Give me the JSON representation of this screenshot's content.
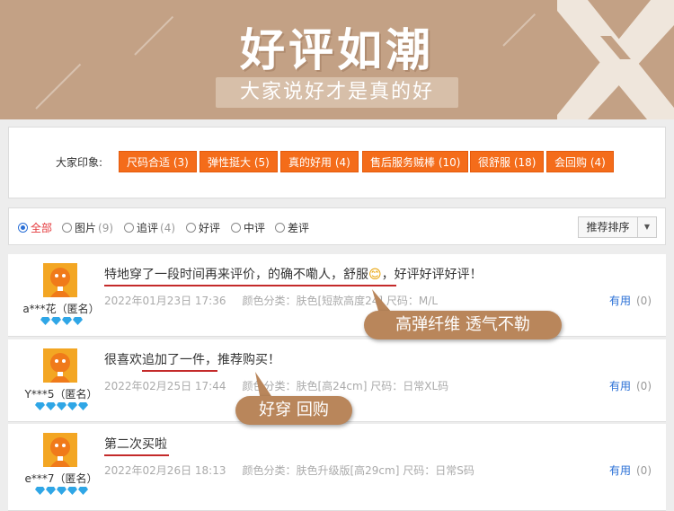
{
  "banner": {
    "title": "好评如潮",
    "subtitle": "大家说好才是真的好"
  },
  "impressions": {
    "label": "大家印象:",
    "tags": [
      {
        "text": "尺码合适 (3)"
      },
      {
        "text": "弹性挺大 (5)"
      },
      {
        "text": "真的好用 (4)"
      },
      {
        "text": "售后服务贼棒 (10)"
      },
      {
        "text": "很舒服 (18)"
      },
      {
        "text": "会回购 (4)"
      }
    ]
  },
  "filter": {
    "options": [
      {
        "label": "全部",
        "count": "",
        "selected": true
      },
      {
        "label": "图片",
        "count": "(9)",
        "selected": false
      },
      {
        "label": "追评",
        "count": "(4)",
        "selected": false
      },
      {
        "label": "好评",
        "count": "",
        "selected": false
      },
      {
        "label": "中评",
        "count": "",
        "selected": false
      },
      {
        "label": "差评",
        "count": "",
        "selected": false
      }
    ],
    "sort_label": "推荐排序"
  },
  "reviews": [
    {
      "user": "a***花（匿名）",
      "text_before": "特地穿了一段时间再来评价，的确不嘞人，舒服",
      "emoji": "😊",
      "text_after": "，好评好评好评！",
      "date": "2022年01月23日 17:36",
      "sku": "颜色分类：肤色[短款高度24]  尺码：M/L",
      "useful_label": "有用",
      "useful_count": "(0)",
      "gem_count": 4
    },
    {
      "user": "Y***5（匿名）",
      "text_before": "很喜欢追加了一件，推荐购买！",
      "emoji": "",
      "text_after": "",
      "date": "2022年02月25日 17:44",
      "sku": "颜色分类：肤色[高24cm]  尺码：日常XL码",
      "useful_label": "有用",
      "useful_count": "(0)",
      "gem_count": 5
    },
    {
      "user": "e***7（匿名）",
      "text_before": "第二次买啦",
      "emoji": "",
      "text_after": "",
      "date": "2022年02月26日 18:13",
      "sku": "颜色分类：肤色升级版[高29cm]  尺码：日常S码",
      "useful_label": "有用",
      "useful_count": "(0)",
      "gem_count": 5
    }
  ],
  "callouts": [
    {
      "text": "高弹纤维 透气不勒"
    },
    {
      "text": "好穿 回购"
    }
  ],
  "colors": {
    "banner": "#c3a185",
    "tag": "#f46c1a",
    "callout": "#b9865b",
    "underline": "#c42a2a",
    "link": "#2a6fd6"
  }
}
